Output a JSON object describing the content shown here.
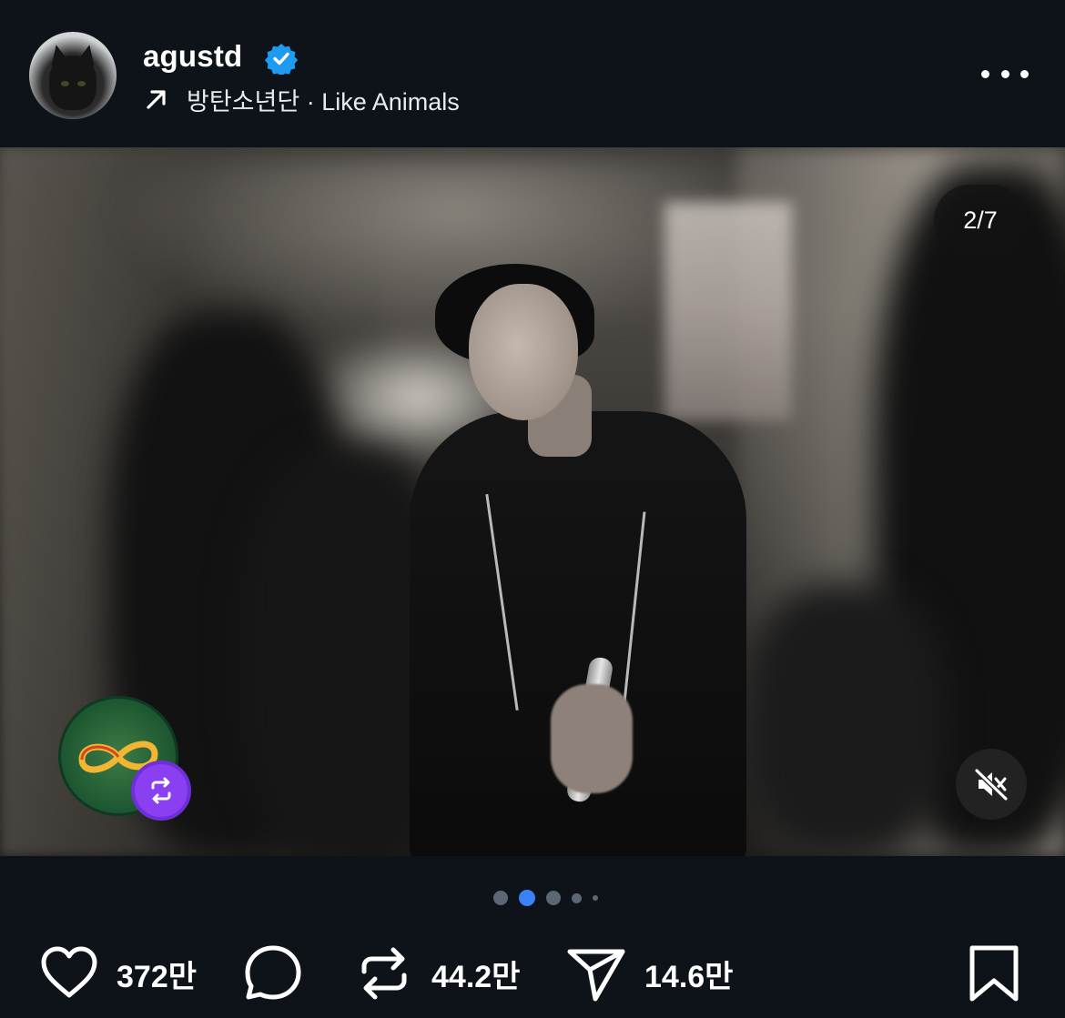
{
  "post": {
    "username": "agustd",
    "verified": true,
    "music": "방탄소년단 · Like Animals",
    "slide_counter": "2/7",
    "slides_total": 5,
    "active_slide": 1
  },
  "actions": {
    "like_count": "372만",
    "repost_count": "44.2만",
    "share_count": "14.6만"
  },
  "colors": {
    "background": "#0e131a",
    "verified_blue": "#1d9bf0",
    "active_dot": "#3b82f6",
    "repost_badge": "#8a3ff2"
  },
  "icons": {
    "verified": "verified-badge-icon",
    "music": "arrow-up-right-icon",
    "more": "more-dots-icon",
    "like": "heart-icon",
    "comment": "comment-bubble-icon",
    "repost": "repost-icon",
    "share": "send-icon",
    "save": "bookmark-icon",
    "mute": "volume-muted-icon"
  }
}
